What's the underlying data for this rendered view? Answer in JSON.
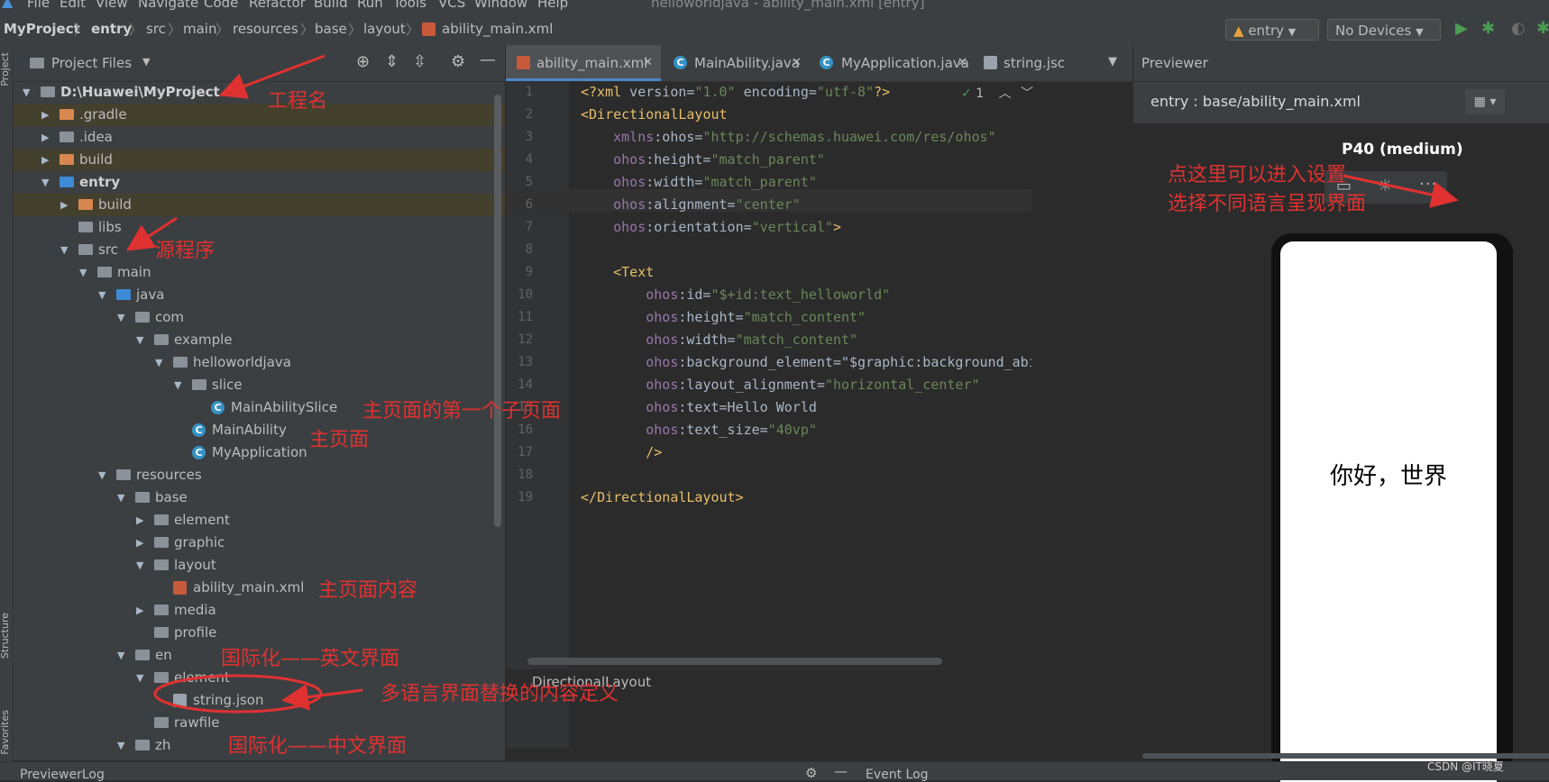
{
  "menubar": {
    "items": [
      "File",
      "Edit",
      "View",
      "Navigate",
      "Code",
      "Refactor",
      "Build",
      "Run",
      "Tools",
      "VCS",
      "Window",
      "Help"
    ],
    "window_title": "helloworldjava - ability_main.xml [entry]"
  },
  "navbar": {
    "breadcrumbs": [
      "MyProject",
      "entry",
      "src",
      "main",
      "resources",
      "base",
      "layout",
      "ability_main.xml"
    ],
    "run_config": "entry",
    "device": "No Devices"
  },
  "side_strip": {
    "project": "Project",
    "structure": "Structure",
    "favorites": "Favorites"
  },
  "project_panel": {
    "header_label": "Project Files",
    "tree": [
      {
        "label": "D:\\Huawei\\MyProject",
        "bold": true,
        "expanded": true
      },
      {
        "label": ".gradle",
        "expanded": false
      },
      {
        "label": ".idea",
        "expanded": false
      },
      {
        "label": "build",
        "expanded": false
      },
      {
        "label": "entry",
        "bold": true,
        "expanded": true
      },
      {
        "label": "build",
        "expanded": false
      },
      {
        "label": "libs"
      },
      {
        "label": "src",
        "expanded": true
      },
      {
        "label": "main",
        "expanded": true
      },
      {
        "label": "java",
        "expanded": true
      },
      {
        "label": "com",
        "expanded": true
      },
      {
        "label": "example",
        "expanded": true
      },
      {
        "label": "helloworldjava",
        "expanded": true
      },
      {
        "label": "slice",
        "expanded": true
      },
      {
        "label": "MainAbilitySlice"
      },
      {
        "label": "MainAbility"
      },
      {
        "label": "MyApplication"
      },
      {
        "label": "resources",
        "expanded": true
      },
      {
        "label": "base",
        "expanded": true
      },
      {
        "label": "element",
        "expanded": false
      },
      {
        "label": "graphic",
        "expanded": false
      },
      {
        "label": "layout",
        "expanded": true
      },
      {
        "label": "ability_main.xml"
      },
      {
        "label": "media",
        "expanded": false
      },
      {
        "label": "profile"
      },
      {
        "label": "en",
        "expanded": true
      },
      {
        "label": "element",
        "expanded": true
      },
      {
        "label": "string.json"
      },
      {
        "label": "rawfile"
      },
      {
        "label": "zh",
        "expanded": true
      }
    ]
  },
  "editor": {
    "tabs": [
      {
        "label": "ability_main.xml",
        "active": true
      },
      {
        "label": "MainAbility.java"
      },
      {
        "label": "MyApplication.java"
      },
      {
        "label": "string.jsc"
      }
    ],
    "inspection_count": "1",
    "lines": [
      "<?xml version=\"1.0\" encoding=\"utf-8\"?>",
      "<DirectionalLayout",
      "    xmlns:ohos=\"http://schemas.huawei.com/res/ohos\"",
      "    ohos:height=\"match_parent\"",
      "    ohos:width=\"match_parent\"",
      "    ohos:alignment=\"center\"",
      "    ohos:orientation=\"vertical\">",
      "",
      "    <Text",
      "        ohos:id=\"$+id:text_helloworld\"",
      "        ohos:height=\"match_content\"",
      "        ohos:width=\"match_content\"",
      "        ohos:background_element=\"$graphic:background_ability_m",
      "        ohos:layout_alignment=\"horizontal_center\"",
      "        ohos:text=Hello World",
      "        ohos:text_size=\"40vp\"",
      "        />",
      "",
      "</DirectionalLayout>"
    ],
    "breadcrumb_footer": "DirectionalLayout"
  },
  "previewer": {
    "title": "Previewer",
    "file_path": "entry : base/ability_main.xml",
    "device_label": "P40 (medium)",
    "phone_text": "你好，世界"
  },
  "bottom": {
    "previewer_log": "PreviewerLog",
    "event_log": "Event Log",
    "watermark": "CSDN @IT晓夏"
  },
  "annotations": {
    "project_name": "工程名",
    "source": "源程序",
    "first_subpage": "主页面的第一个子页面",
    "main_page": "主页面",
    "main_content": "主页面内容",
    "i18n_en": "国际化——英文界面",
    "multi_lang": "多语言界面替换的内容定义",
    "i18n_zh": "国际化——中文界面",
    "settings_line1": "点这里可以进入设置",
    "settings_line2": "选择不同语言呈现界面"
  },
  "colors": {
    "accent": "#4a88c7",
    "annotation_red": "#e03131",
    "highlight_row": "#44402e",
    "tag_yellow": "#e8bf6a",
    "string_green": "#6a8759",
    "namespace_purple": "#9876aa"
  }
}
